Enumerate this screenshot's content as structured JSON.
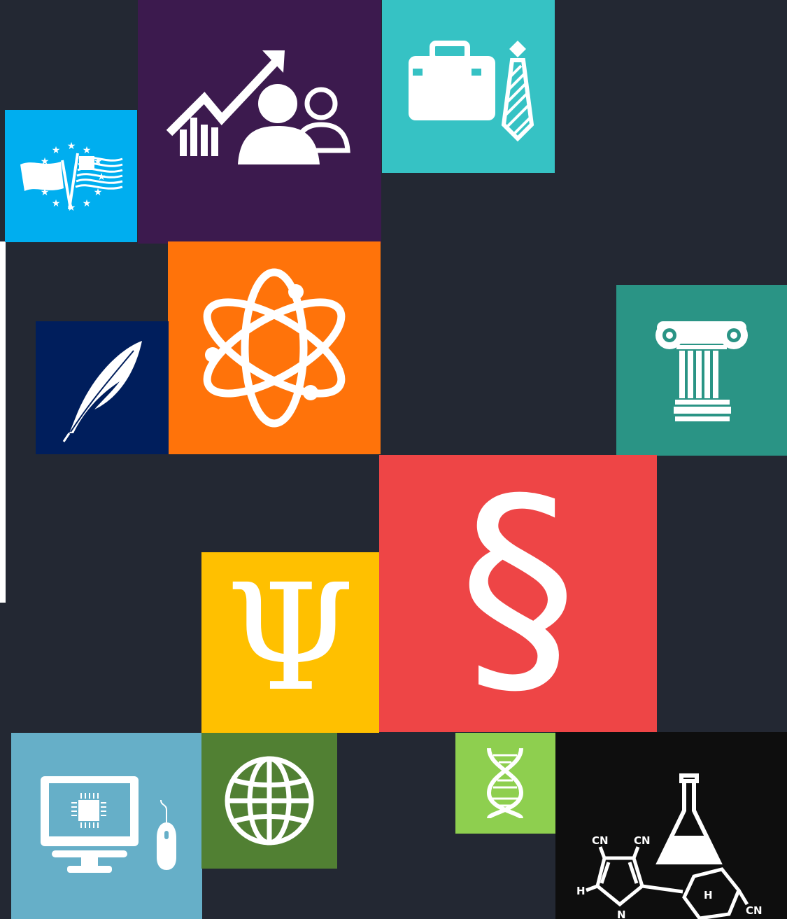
{
  "colors": {
    "background": "#232833",
    "edge_bar": "#ffffff",
    "icon": "#ffffff"
  },
  "tiles": [
    {
      "name": "eu-us-flags-tile",
      "icon": "eu-us-flags-icon",
      "color": "#00AEEF"
    },
    {
      "name": "business-growth-tile",
      "icon": "growth-chart-people-icon",
      "color": "#3C1A4E"
    },
    {
      "name": "business-tile",
      "icon": "briefcase-tie-icon",
      "color": "#36C2C4"
    },
    {
      "name": "physics-tile",
      "icon": "atom-icon",
      "color": "#FF730A"
    },
    {
      "name": "literature-tile",
      "icon": "feather-quill-icon",
      "color": "#001E5C"
    },
    {
      "name": "history-tile",
      "icon": "ionic-column-icon",
      "color": "#2A9485"
    },
    {
      "name": "law-tile",
      "icon": "section-sign-icon",
      "color": "#EE4546"
    },
    {
      "name": "psychology-tile",
      "icon": "psi-icon",
      "color": "#FFC000"
    },
    {
      "name": "computer-science-tile",
      "icon": "computer-mouse-icon",
      "color": "#66AFC8"
    },
    {
      "name": "geography-tile",
      "icon": "globe-icon",
      "color": "#518033"
    },
    {
      "name": "biology-tile",
      "icon": "dna-icon",
      "color": "#8ECF4F"
    },
    {
      "name": "chemistry-tile",
      "icon": "chemistry-flask-molecule-icon",
      "color": "#0E0E0E"
    }
  ],
  "psychology": {
    "symbol": "Ψ"
  },
  "law": {
    "symbol": "§"
  },
  "chemistry": {
    "labels": {
      "cn_left": "CN",
      "cn_right": "CN",
      "h_left": "H",
      "n_bottom": "N",
      "h_ring": "H",
      "cn_ring": "CN"
    }
  }
}
